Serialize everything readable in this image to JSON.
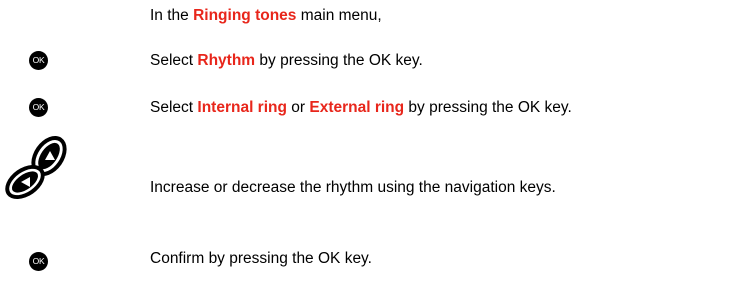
{
  "instructions": {
    "intro": {
      "before": "In the ",
      "highlight": "Ringing tones",
      "after": " main menu,"
    },
    "step1": {
      "icon": "ok-key-icon",
      "icon_label": "OK",
      "before": "Select ",
      "highlight": "Rhythm",
      "after": " by pressing the OK key."
    },
    "step2": {
      "icon": "ok-key-icon",
      "icon_label": "OK",
      "before": "Select ",
      "highlight1": "Internal ring",
      "middle": " or ",
      "highlight2": "External ring",
      "after": " by pressing the OK key."
    },
    "step3": {
      "icon": "navigation-keys-icon",
      "text": "Increase or decrease the rhythm using the navigation keys."
    },
    "step4": {
      "icon": "ok-key-icon",
      "icon_label": "OK",
      "text": "Confirm by pressing the OK key."
    }
  },
  "colors": {
    "highlight": "#e8261b",
    "text": "#000000",
    "icon": "#000000"
  }
}
